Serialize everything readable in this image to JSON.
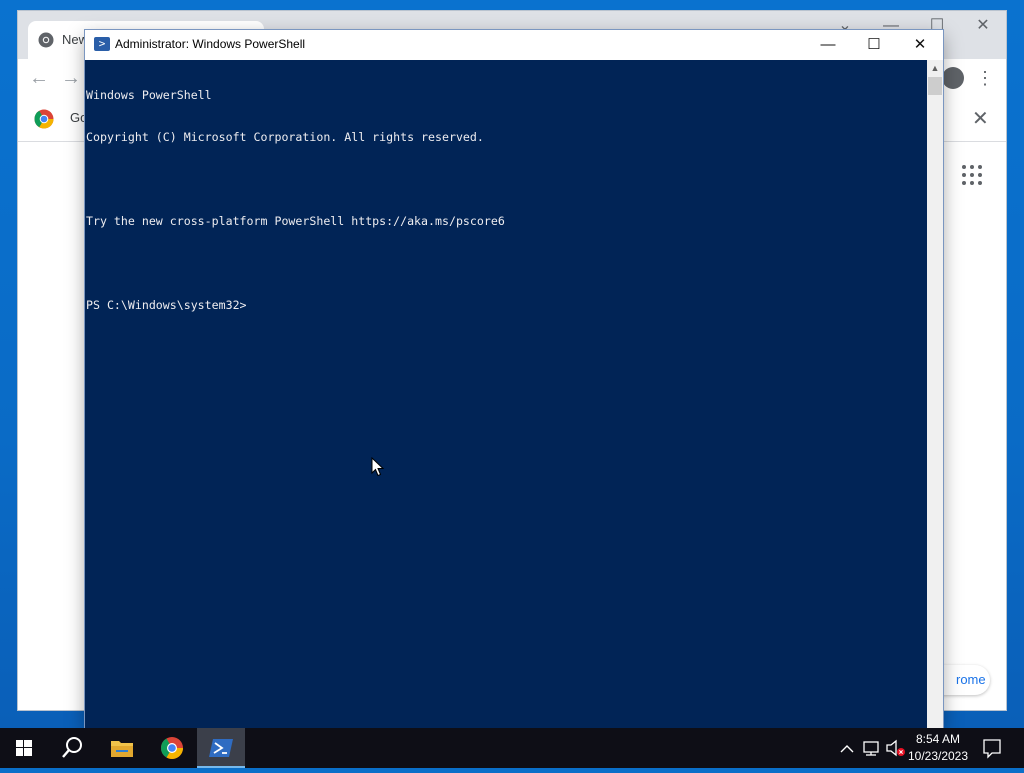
{
  "chrome": {
    "tab_title": "New",
    "infobar_text": "Go",
    "pill_text": "rome",
    "close_glyph": "✕",
    "minimize_glyph": "—",
    "maximize_glyph": "☐",
    "back_glyph": "←",
    "forward_glyph": "→",
    "menu_glyph": "⋮"
  },
  "powershell": {
    "title": "Administrator: Windows PowerShell",
    "lines": [
      "Windows PowerShell",
      "Copyright (C) Microsoft Corporation. All rights reserved.",
      "",
      "Try the new cross-platform PowerShell https://aka.ms/pscore6",
      "",
      "PS C:\\Windows\\system32>"
    ],
    "minimize_glyph": "—",
    "maximize_glyph": "☐",
    "close_glyph": "✕",
    "background": "#012456"
  },
  "taskbar": {
    "items": [
      "start",
      "search",
      "file-explorer",
      "chrome",
      "powershell"
    ],
    "active": "powershell",
    "time": "8:54 AM",
    "date": "10/23/2023"
  }
}
